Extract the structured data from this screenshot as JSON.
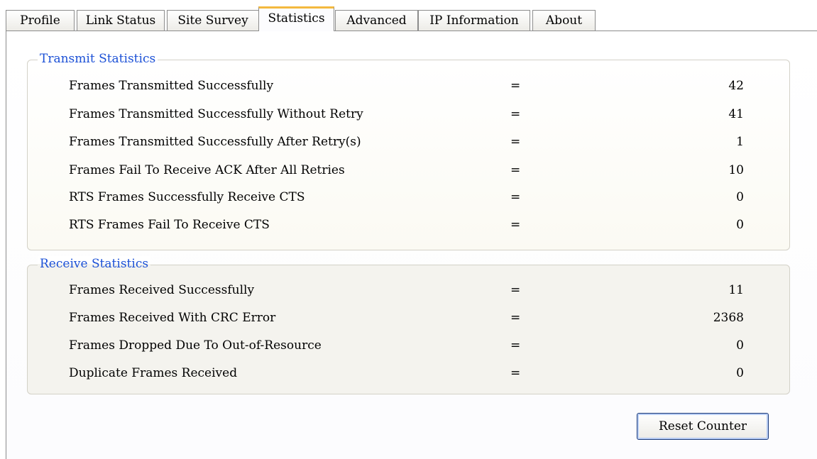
{
  "tabs": [
    {
      "label": "Profile",
      "active": false
    },
    {
      "label": "Link Status",
      "active": false
    },
    {
      "label": "Site Survey",
      "active": false
    },
    {
      "label": "Statistics",
      "active": true
    },
    {
      "label": "Advanced",
      "active": false
    },
    {
      "label": "IP Information",
      "active": false
    },
    {
      "label": "About",
      "active": false
    }
  ],
  "transmit": {
    "title": "Transmit Statistics",
    "rows": [
      {
        "label": "Frames Transmitted Successfully",
        "eq": "=",
        "value": "42"
      },
      {
        "label": "Frames Transmitted Successfully  Without Retry",
        "eq": "=",
        "value": "41"
      },
      {
        "label": "Frames Transmitted Successfully After Retry(s)",
        "eq": "=",
        "value": "1"
      },
      {
        "label": "Frames Fail To Receive ACK After All Retries",
        "eq": "=",
        "value": "10"
      },
      {
        "label": "RTS Frames Successfully Receive CTS",
        "eq": "=",
        "value": "0"
      },
      {
        "label": "RTS Frames Fail To Receive CTS",
        "eq": "=",
        "value": "0"
      }
    ]
  },
  "receive": {
    "title": "Receive Statistics",
    "rows": [
      {
        "label": "Frames Received Successfully",
        "eq": "=",
        "value": "11"
      },
      {
        "label": "Frames Received  With CRC Error",
        "eq": "=",
        "value": "2368"
      },
      {
        "label": "Frames Dropped Due To Out-of-Resource",
        "eq": "=",
        "value": "0"
      },
      {
        "label": "Duplicate Frames Received",
        "eq": "=",
        "value": "0"
      }
    ]
  },
  "reset_button": {
    "label": "Reset Counter"
  },
  "colors": {
    "group_title": "#1b50d6",
    "active_tab_accent": "#f4b93f"
  }
}
